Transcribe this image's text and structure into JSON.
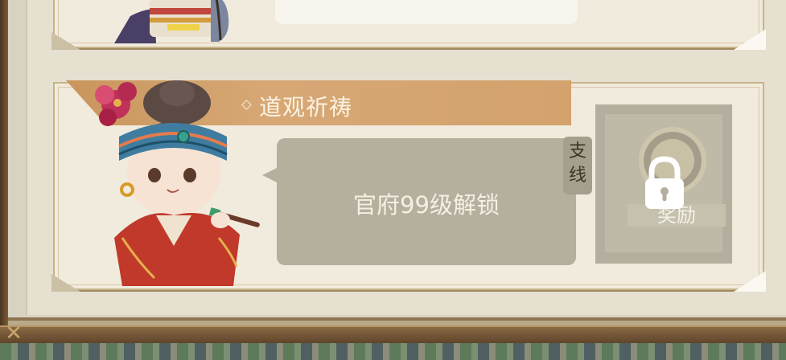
{
  "quest": {
    "title": "道观祈祷",
    "unlock_text": "官府99级解锁",
    "tag_line1": "支",
    "tag_line2": "线",
    "reward_label": "奖励"
  },
  "icons": {
    "lock": "lock-icon",
    "coin": "coin-icon"
  },
  "colors": {
    "ribbon": "#d4a46f",
    "parchment": "#f1ebdd",
    "locked_overlay": "#b3ae9d"
  }
}
